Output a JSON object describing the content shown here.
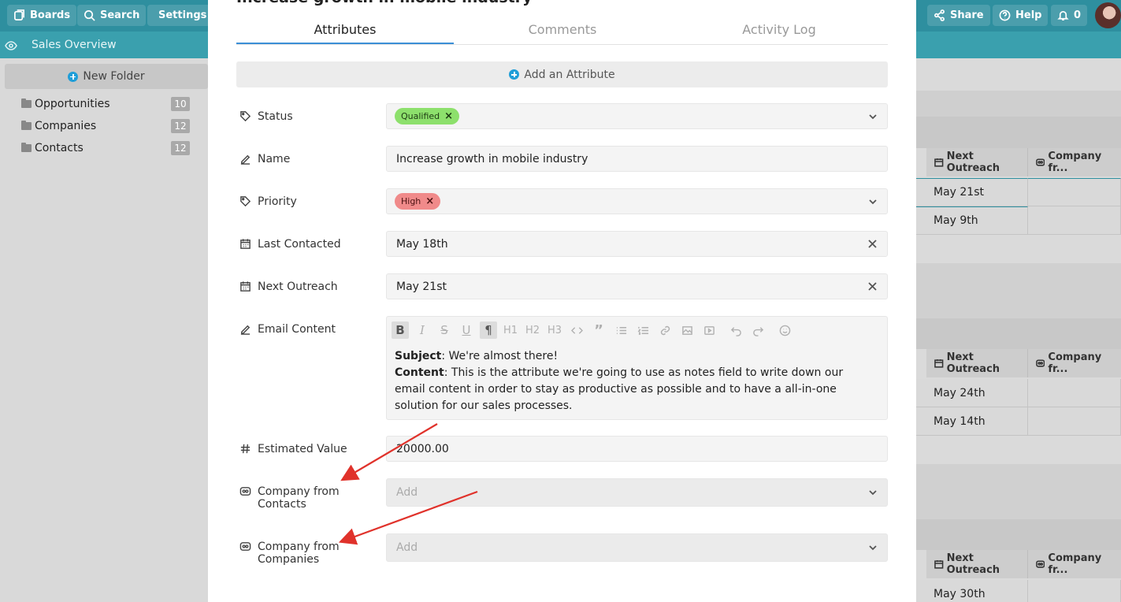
{
  "topbar": {
    "boards": "Boards",
    "search": "Search",
    "settings": "Settings",
    "share": "Share",
    "help": "Help",
    "notifications": "0"
  },
  "subbar": {
    "title": "Sales Overview"
  },
  "sidebar": {
    "new_folder": "New Folder",
    "folders": [
      {
        "label": "Opportunities",
        "count": "10"
      },
      {
        "label": "Companies",
        "count": "12"
      },
      {
        "label": "Contacts",
        "count": "12"
      }
    ]
  },
  "board": {
    "col_next_outreach": "Next Outreach",
    "col_company": "Company fr...",
    "group1": [
      "May 21st",
      "May 9th"
    ],
    "group2": [
      "May 24th",
      "May 14th"
    ],
    "group3": [
      "May 30th"
    ]
  },
  "modal": {
    "title": "Increase growth in mobile industry",
    "tabs": [
      "Attributes",
      "Comments",
      "Activity Log"
    ],
    "add_attribute": "Add an Attribute",
    "fields": {
      "status_label": "Status",
      "status_tag": "Qualified",
      "name_label": "Name",
      "name_value": "Increase growth in mobile industry",
      "priority_label": "Priority",
      "priority_tag": "High",
      "last_contacted_label": "Last Contacted",
      "last_contacted_value": "May 18th",
      "next_outreach_label": "Next Outreach",
      "next_outreach_value": "May 21st",
      "email_label": "Email Content",
      "email_subject_key": "Subject",
      "email_subject": ": We're almost there!",
      "email_content_key": "Content",
      "email_content": ": This is the attribute we're going to use as notes field to write down our email content in order to stay as productive as possible and to have a all-in-one solution for our sales processes.",
      "estimated_label": "Estimated Value",
      "estimated_value": "20000.00",
      "company_contacts_label_1": "Company from",
      "company_contacts_label_2": "Contacts",
      "company_contacts_placeholder": "Add",
      "company_companies_label_1": "Company from",
      "company_companies_label_2": "Companies",
      "company_companies_placeholder": "Add"
    },
    "toolbar": {
      "h1": "H1",
      "h2": "H2",
      "h3": "H3"
    }
  },
  "colors": {
    "topbar": "#2e8f9f",
    "accent": "#3b8fd6",
    "tag_green": "#8de06c",
    "tag_red": "#f08a8a",
    "arrow": "#e0322b"
  }
}
